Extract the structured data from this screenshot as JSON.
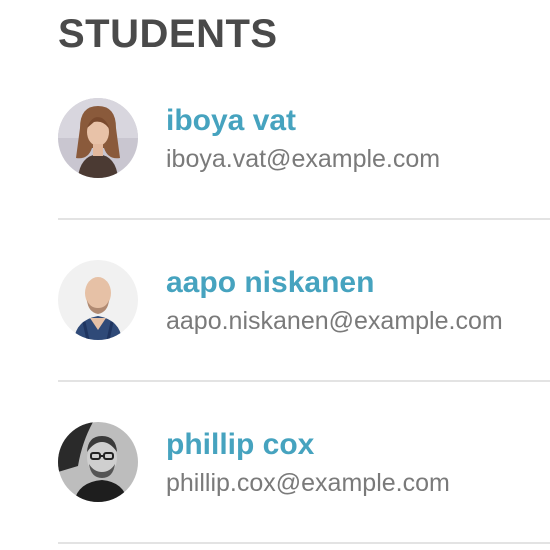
{
  "page": {
    "heading": "STUDENTS"
  },
  "students": [
    {
      "name": "iboya vat",
      "email": "iboya.vat@example.com",
      "avatar": "woman-portrait-photo"
    },
    {
      "name": "aapo niskanen",
      "email": "aapo.niskanen@example.com",
      "avatar": "bald-man-portrait-photo"
    },
    {
      "name": "phillip cox",
      "email": "phillip.cox@example.com",
      "avatar": "man-with-glasses-bw-photo"
    }
  ],
  "colors": {
    "heading": "#4a4a4a",
    "name_link": "#46a3bf",
    "email": "#7a7a7a",
    "divider": "#e3e3e3"
  }
}
